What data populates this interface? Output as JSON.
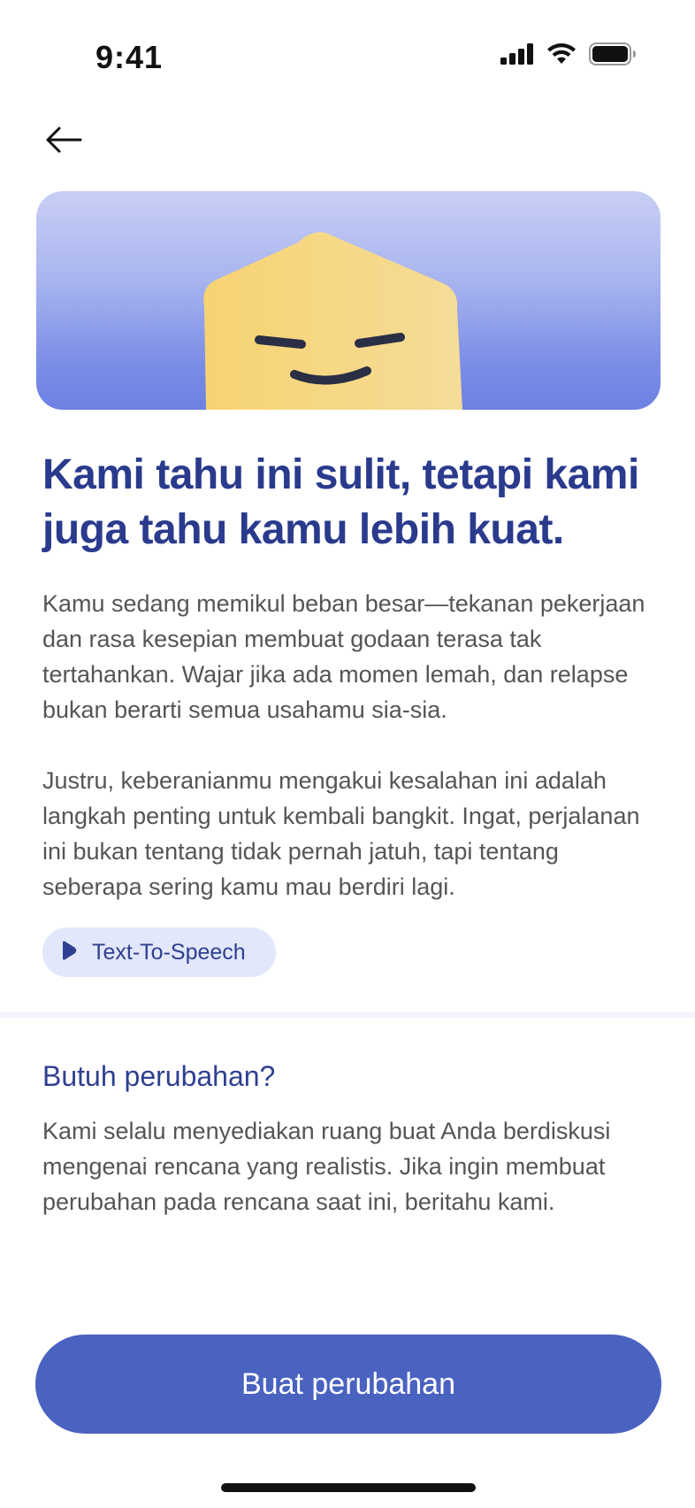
{
  "status_bar": {
    "time": "9:41",
    "icons": [
      "cellular-signal-icon",
      "wifi-icon",
      "battery-icon"
    ]
  },
  "nav": {
    "back_icon": "arrow-left-icon"
  },
  "hero": {
    "illustration": "smiling-yellow-pentagon-character",
    "colors": {
      "background_top": "#c8cff4",
      "background_bottom": "#6d81e3",
      "character": "#f7d77a",
      "face": "#2b2f45"
    }
  },
  "content": {
    "headline": "Kami tahu ini sulit, tetapi kami juga tahu kamu lebih kuat.",
    "paragraph_1": "Kamu sedang memikul beban besar—tekanan pekerjaan dan rasa kesepian membuat godaan terasa tak tertahankan. Wajar jika ada momen lemah, dan relapse bukan berarti semua usahamu sia-sia.",
    "paragraph_2": "Justru, keberanianmu mengakui kesalahan ini adalah langkah penting untuk kembali bangkit. Ingat, perjalanan ini bukan tentang tidak pernah jatuh, tapi tentang seberapa sering kamu mau berdiri lagi.",
    "tts": {
      "label": "Text-To-Speech",
      "icon": "play-icon"
    }
  },
  "change_section": {
    "title": "Butuh perubahan?",
    "body": "Kami selalu menyediakan ruang buat Anda berdiskusi mengenai rencana yang realistis. Jika ingin membuat perubahan pada rencana saat ini, beritahu kami."
  },
  "cta": {
    "label": "Buat perubahan"
  },
  "colors": {
    "headline": "#2a3a8c",
    "accent": "#2f3f91",
    "button": "#4a62c0",
    "pill_bg": "#e2e7fb",
    "body_text": "#555555"
  }
}
